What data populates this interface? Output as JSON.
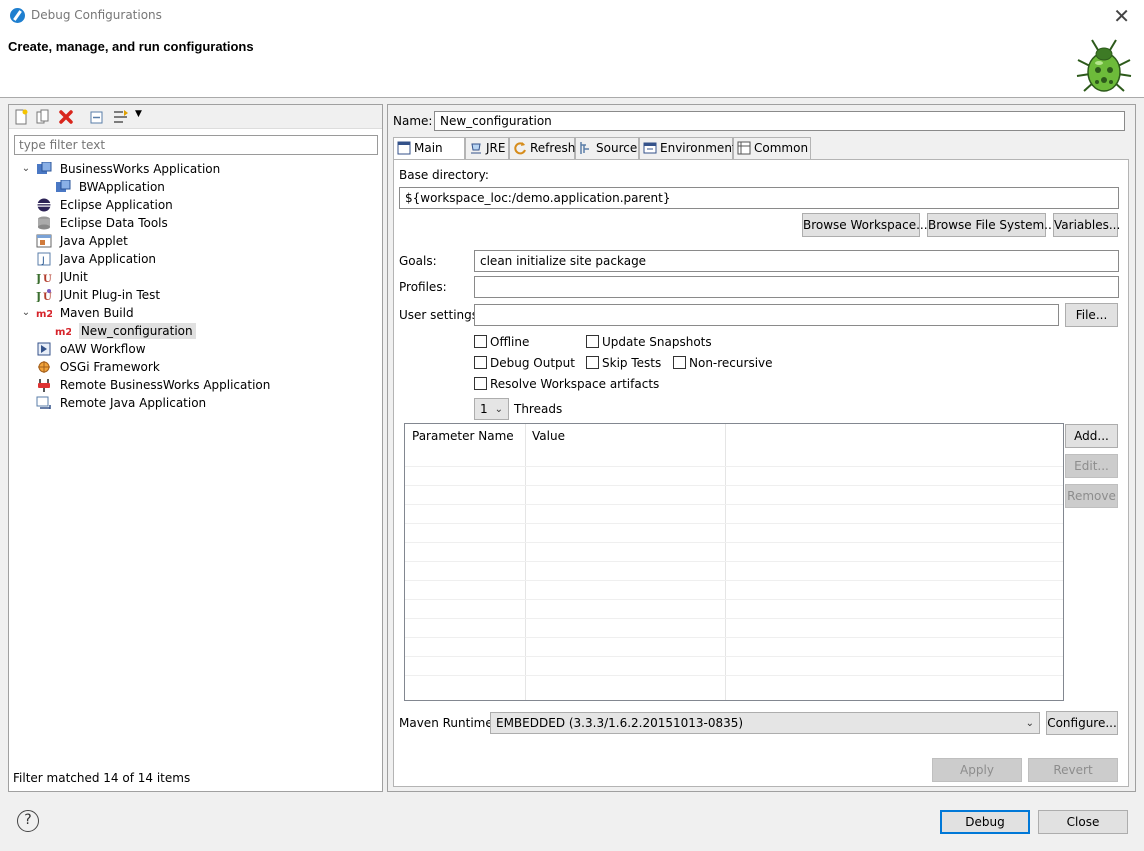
{
  "window": {
    "title": "Debug Configurations",
    "heading": "Create, manage, and run configurations"
  },
  "left": {
    "filter_placeholder": "type filter text",
    "tree": [
      {
        "label": "BusinessWorks Application",
        "icon": "bw-icon",
        "expanded": true
      },
      {
        "label": "BWApplication",
        "icon": "bw-icon"
      },
      {
        "label": "Eclipse Application",
        "icon": "eclipse-icon"
      },
      {
        "label": "Eclipse Data Tools",
        "icon": "database-icon"
      },
      {
        "label": "Java Applet",
        "icon": "applet-icon"
      },
      {
        "label": "Java Application",
        "icon": "java-app-icon"
      },
      {
        "label": "JUnit",
        "icon": "junit-icon"
      },
      {
        "label": "JUnit Plug-in Test",
        "icon": "junit-plugin-icon"
      },
      {
        "label": "Maven Build",
        "icon": "maven-icon",
        "expanded": true
      },
      {
        "label": "New_configuration",
        "icon": "maven-icon",
        "selected": true
      },
      {
        "label": "oAW Workflow",
        "icon": "workflow-icon"
      },
      {
        "label": "OSGi Framework",
        "icon": "osgi-icon"
      },
      {
        "label": "Remote BusinessWorks Application",
        "icon": "remote-bw-icon"
      },
      {
        "label": "Remote Java Application",
        "icon": "remote-java-icon"
      }
    ],
    "filter_status": "Filter matched 14 of 14 items"
  },
  "right": {
    "name_label": "Name:",
    "name_value": "New_configuration",
    "tabs": [
      {
        "label": "Main",
        "icon": "main-tab-icon",
        "active": true
      },
      {
        "label": "JRE",
        "icon": "jre-icon"
      },
      {
        "label": "Refresh",
        "icon": "refresh-icon"
      },
      {
        "label": "Source",
        "icon": "source-icon"
      },
      {
        "label": "Environment",
        "icon": "environment-icon"
      },
      {
        "label": "Common",
        "icon": "common-icon"
      }
    ],
    "base_dir_label": "Base directory:",
    "base_dir_value": "${workspace_loc:/demo.application.parent}",
    "browse_workspace": "Browse Workspace...",
    "browse_fs": "Browse File System...",
    "variables": "Variables...",
    "goals_label": "Goals:",
    "goals_value": "clean initialize site package",
    "profiles_label": "Profiles:",
    "profiles_value": "",
    "user_settings_label": "User settings:",
    "user_settings_value": "",
    "file_button": "File...",
    "checkboxes": {
      "offline": "Offline",
      "update_snapshots": "Update Snapshots",
      "debug_output": "Debug Output",
      "skip_tests": "Skip Tests",
      "non_recursive": "Non-recursive",
      "resolve_workspace": "Resolve Workspace artifacts"
    },
    "threads_value": "1",
    "threads_label": "Threads",
    "param_headers": [
      "Parameter Name",
      "Value"
    ],
    "add": "Add...",
    "edit": "Edit...",
    "remove": "Remove",
    "runtime_label": "Maven Runtime:",
    "runtime_value": "EMBEDDED (3.3.3/1.6.2.20151013-0835)",
    "configure": "Configure...",
    "apply": "Apply",
    "revert": "Revert"
  },
  "footer": {
    "help": "?",
    "debug": "Debug",
    "close": "Close"
  }
}
